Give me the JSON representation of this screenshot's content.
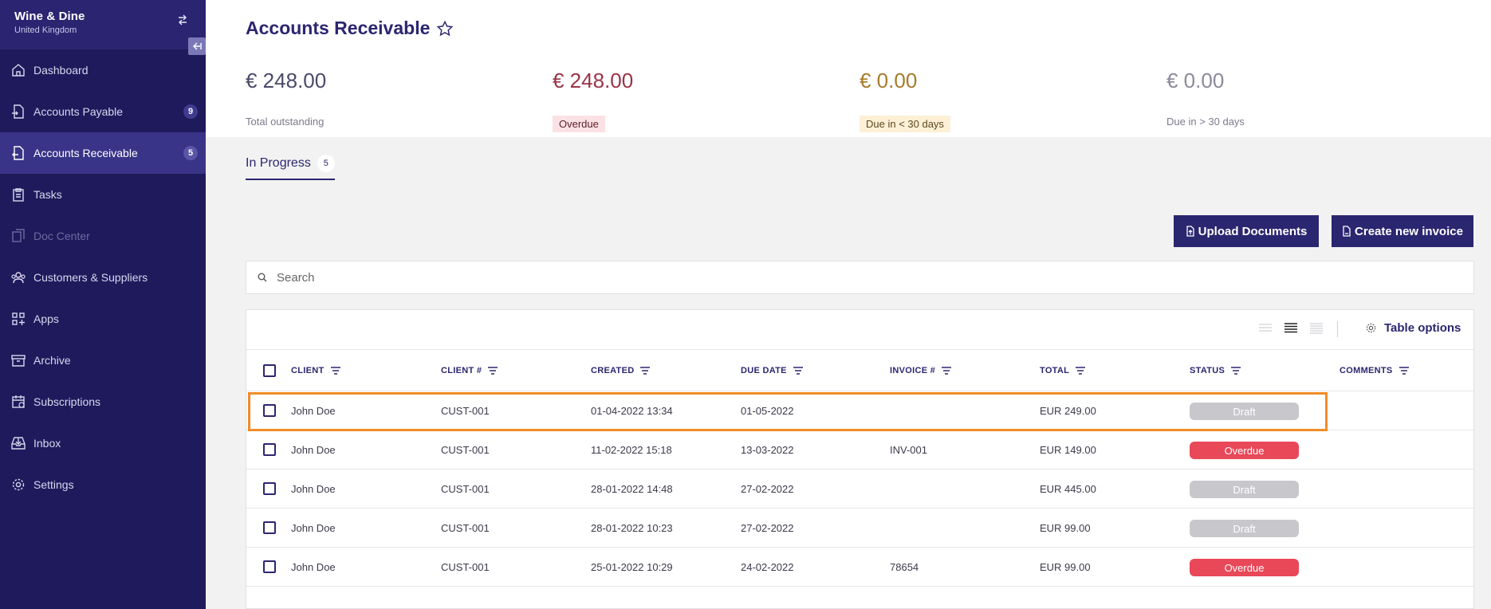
{
  "sidebar": {
    "company_name": "Wine & Dine",
    "company_country": "United Kingdom",
    "items": [
      {
        "label": "Dashboard",
        "icon": "home-icon"
      },
      {
        "label": "Accounts Payable",
        "icon": "invoice-in-icon",
        "badge": "9"
      },
      {
        "label": "Accounts Receivable",
        "icon": "invoice-out-icon",
        "badge": "5",
        "active": true
      },
      {
        "label": "Tasks",
        "icon": "clipboard-icon"
      },
      {
        "label": "Doc Center",
        "icon": "documents-icon",
        "disabled": true
      },
      {
        "label": "Customers & Suppliers",
        "icon": "people-icon"
      },
      {
        "label": "Apps",
        "icon": "apps-icon"
      },
      {
        "label": "Archive",
        "icon": "archive-icon"
      },
      {
        "label": "Subscriptions",
        "icon": "calendar-icon"
      },
      {
        "label": "Inbox",
        "icon": "inbox-icon"
      },
      {
        "label": "Settings",
        "icon": "gear-icon"
      }
    ]
  },
  "header": {
    "title": "Accounts Receivable",
    "kpis": [
      {
        "amount": "€ 248.00",
        "label": "Total outstanding",
        "color": "#4a4a6a"
      },
      {
        "amount": "€ 248.00",
        "label": "Overdue",
        "color": "#9b3345"
      },
      {
        "amount": "€ 0.00",
        "label": "Due in < 30 days",
        "color": "#a77b2c"
      },
      {
        "amount": "€ 0.00",
        "label": "Due in > 30 days",
        "color": "#8a8a9a"
      }
    ]
  },
  "tabs": [
    {
      "label": "In Progress",
      "count": "5"
    }
  ],
  "actions": {
    "upload_label": "Upload Documents",
    "create_label": "Create new invoice"
  },
  "search": {
    "placeholder": "Search",
    "value": ""
  },
  "table": {
    "options_label": "Table options",
    "columns": [
      "CLIENT",
      "CLIENT #",
      "CREATED",
      "DUE DATE",
      "INVOICE #",
      "TOTAL",
      "STATUS",
      "COMMENTS"
    ],
    "rows": [
      {
        "client": "John Doe",
        "client_no": "CUST-001",
        "created": "01-04-2022 13:34",
        "due": "01-05-2022",
        "invoice": "",
        "total": "EUR 249.00",
        "status": "Draft"
      },
      {
        "client": "John Doe",
        "client_no": "CUST-001",
        "created": "11-02-2022 15:18",
        "due": "13-03-2022",
        "invoice": "INV-001",
        "total": "EUR 149.00",
        "status": "Overdue"
      },
      {
        "client": "John Doe",
        "client_no": "CUST-001",
        "created": "28-01-2022 14:48",
        "due": "27-02-2022",
        "invoice": "",
        "total": "EUR 445.00",
        "status": "Draft"
      },
      {
        "client": "John Doe",
        "client_no": "CUST-001",
        "created": "28-01-2022 10:23",
        "due": "27-02-2022",
        "invoice": "",
        "total": "EUR 99.00",
        "status": "Draft"
      },
      {
        "client": "John Doe",
        "client_no": "CUST-001",
        "created": "25-01-2022 10:29",
        "due": "24-02-2022",
        "invoice": "78654",
        "total": "EUR 99.00",
        "status": "Overdue"
      }
    ]
  },
  "colors": {
    "sidebar": "#1f1a5c",
    "primary": "#2b2670",
    "overdue": "#e84858",
    "draft": "#c8c8cc",
    "highlight": "#f28c28"
  }
}
